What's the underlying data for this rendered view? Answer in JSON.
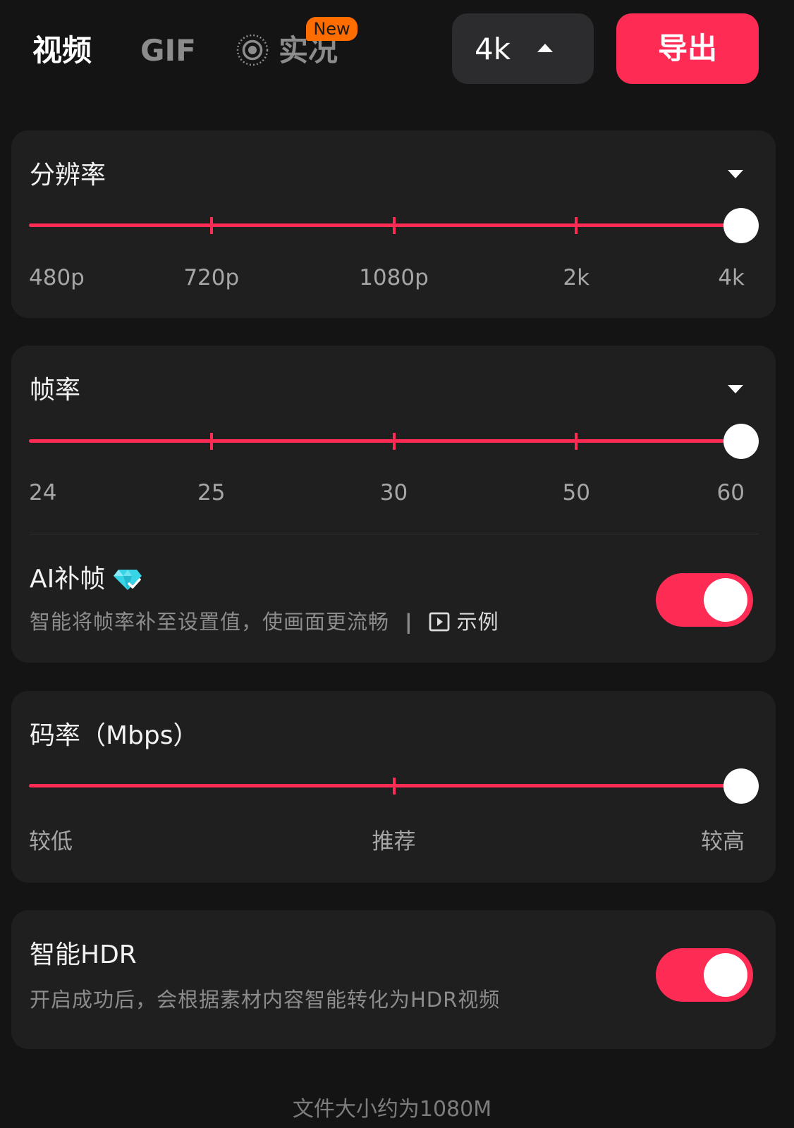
{
  "header": {
    "tabs": [
      {
        "label": "视频",
        "active": true
      },
      {
        "label": "GIF",
        "active": false
      },
      {
        "label": "实况",
        "active": false,
        "badge": "New",
        "icon": "live-photo-icon"
      }
    ],
    "quality_selector": {
      "value": "4k",
      "icon": "caret-up-icon"
    },
    "export_label": "导出"
  },
  "resolution": {
    "title": "分辨率",
    "icon": "caret-down-icon",
    "options": [
      "480p",
      "720p",
      "1080p",
      "2k",
      "4k"
    ],
    "selected_index": 4
  },
  "frame_rate": {
    "title": "帧率",
    "icon": "caret-down-icon",
    "options": [
      "24",
      "25",
      "30",
      "50",
      "60"
    ],
    "selected_index": 4
  },
  "ai_frame_interpolation": {
    "title": "AI补帧",
    "badge_icon": "diamond-icon",
    "description": "智能将帧率补至设置值，使画面更流畅",
    "separator": "|",
    "example_icon": "play-box-icon",
    "example_label": "示例",
    "enabled": true
  },
  "bitrate": {
    "title": "码率（Mbps）",
    "scale_labels": [
      "较低",
      "推荐",
      "较高"
    ],
    "value": 1.0
  },
  "smart_hdr": {
    "title": "智能HDR",
    "description": "开启成功后，会根据素材内容智能转化为HDR视频",
    "enabled": true
  },
  "footer": {
    "file_size_text": "文件大小约为1080M"
  },
  "colors": {
    "accent": "#fe2c55",
    "badge": "#ff6d00",
    "background": "#141414",
    "card": "#1f1f1f",
    "selector_bg": "#2c2c2e"
  }
}
